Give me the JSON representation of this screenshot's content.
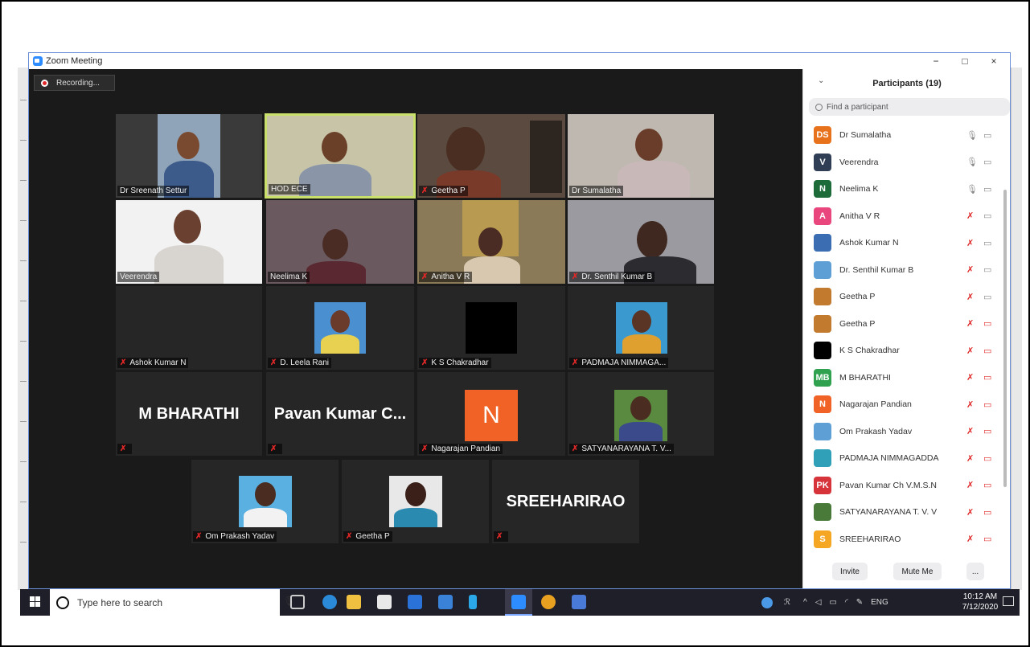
{
  "window": {
    "title": "Zoom Meeting",
    "minimize": "−",
    "maximize": "□",
    "close": "×"
  },
  "recording": {
    "label": "Recording..."
  },
  "tiles": [
    {
      "name": "Dr Sreenath Settur",
      "muted": false
    },
    {
      "name": "HOD ECE",
      "muted": false,
      "active": true
    },
    {
      "name": "Geetha P",
      "muted": true
    },
    {
      "name": "Dr Sumalatha",
      "muted": false
    },
    {
      "name": "Veerendra",
      "muted": false
    },
    {
      "name": "Neelima K",
      "muted": false
    },
    {
      "name": "Anitha V R",
      "muted": true
    },
    {
      "name": "Dr. Senthil Kumar B",
      "muted": true
    },
    {
      "name": "Ashok Kumar N",
      "muted": true
    },
    {
      "name": "D. Leela Rani",
      "muted": true
    },
    {
      "name": "K S Chakradhar",
      "muted": true
    },
    {
      "name": "PADMAJA NIMMAGA...",
      "muted": true
    },
    {
      "name": "",
      "big": "M BHARATHI",
      "muted": true
    },
    {
      "name": "",
      "big": "Pavan Kumar C...",
      "muted": true
    },
    {
      "name": "Nagarajan Pandian",
      "muted": true,
      "letter": "N"
    },
    {
      "name": "SATYANARAYANA T. V...",
      "muted": true
    },
    {
      "name": "Om Prakash Yadav",
      "muted": true
    },
    {
      "name": "Geetha P",
      "muted": true
    },
    {
      "name": "",
      "big": "SREEHARIRAO",
      "muted": true
    }
  ],
  "panel": {
    "title": "Participants (19)",
    "search_placeholder": "Find a participant",
    "participants": [
      {
        "name": "Dr Sumalatha",
        "initials": "DS",
        "color": "#e8711c",
        "mic": "on",
        "cam": "on"
      },
      {
        "name": "Veerendra",
        "initials": "V",
        "color": "#2f3e55",
        "mic": "on",
        "cam": "on"
      },
      {
        "name": "Neelima K",
        "initials": "N",
        "color": "#1e6b3a",
        "mic": "on",
        "cam": "on"
      },
      {
        "name": "Anitha V R",
        "initials": "A",
        "color": "#e8467c",
        "mic": "muted",
        "cam": "on"
      },
      {
        "name": "Ashok Kumar N",
        "initials": "",
        "color": "#3b6db3",
        "mic": "muted",
        "cam": "on"
      },
      {
        "name": "Dr. Senthil Kumar B",
        "initials": "",
        "color": "#5ea0d6",
        "mic": "muted",
        "cam": "on"
      },
      {
        "name": "Geetha P",
        "initials": "",
        "color": "#c27a2e",
        "mic": "muted",
        "cam": "on"
      },
      {
        "name": "Geetha P",
        "initials": "",
        "color": "#c27a2e",
        "mic": "muted",
        "cam": "off"
      },
      {
        "name": "K S Chakradhar",
        "initials": "",
        "color": "#000000",
        "mic": "muted",
        "cam": "off"
      },
      {
        "name": "M BHARATHI",
        "initials": "MB",
        "color": "#2fa14f",
        "mic": "muted",
        "cam": "off"
      },
      {
        "name": "Nagarajan Pandian",
        "initials": "N",
        "color": "#f06225",
        "mic": "muted",
        "cam": "off"
      },
      {
        "name": "Om Prakash Yadav",
        "initials": "",
        "color": "#5ea0d6",
        "mic": "muted",
        "cam": "off"
      },
      {
        "name": "PADMAJA NIMMAGADDA",
        "initials": "",
        "color": "#2fa0b8",
        "mic": "muted",
        "cam": "off"
      },
      {
        "name": "Pavan Kumar Ch V.M.S.N",
        "initials": "PK",
        "color": "#d6333a",
        "mic": "muted",
        "cam": "off"
      },
      {
        "name": "SATYANARAYANA T. V. V",
        "initials": "",
        "color": "#4a7a3a",
        "mic": "muted",
        "cam": "off"
      },
      {
        "name": "SREEHARIRAO",
        "initials": "S",
        "color": "#f5a623",
        "mic": "muted",
        "cam": "off"
      }
    ],
    "invite": "Invite",
    "mute_me": "Mute Me",
    "more": "..."
  },
  "taskbar": {
    "search_placeholder": "Type here to search",
    "language": "ENG",
    "time": "10:12 AM",
    "date": "7/12/2020"
  },
  "icons": {
    "mic_on": "🎙",
    "mic_muted": "✗",
    "cam": "▭"
  }
}
